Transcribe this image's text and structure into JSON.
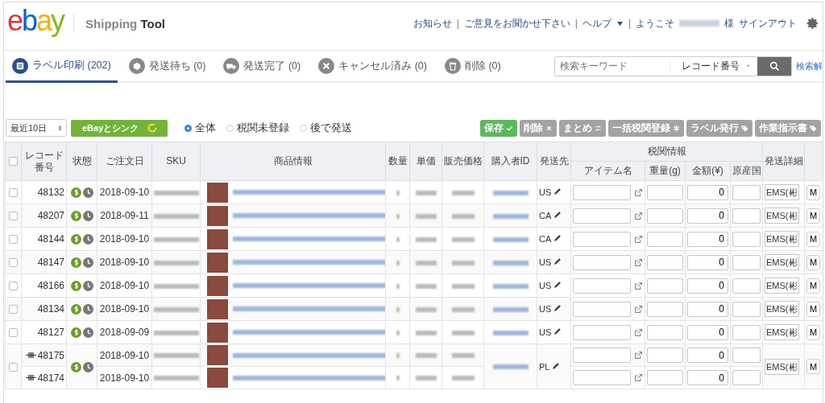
{
  "header": {
    "logo": "ebay",
    "app_name": {
      "light": "Shipping",
      "bold": "Tool"
    },
    "nav": [
      {
        "label": "お知らせ",
        "kind": "link"
      },
      {
        "label": "|",
        "kind": "separator"
      },
      {
        "label": "ご意見をお聞かせ下さい",
        "kind": "link"
      },
      {
        "label": "|",
        "kind": "separator"
      },
      {
        "label": "ヘルプ",
        "kind": "dropdown"
      },
      {
        "label": "|",
        "kind": "separator"
      },
      {
        "label": "ようこそ",
        "kind": "welcome",
        "suffix": "様"
      },
      {
        "label": "サインアウト",
        "kind": "link"
      }
    ]
  },
  "tabs": [
    {
      "label": "ラベル印刷 (202)",
      "kind": "list",
      "selected": true
    },
    {
      "label": "発送待ち (0)",
      "kind": "box",
      "selected": false
    },
    {
      "label": "発送完了 (0)",
      "kind": "truck",
      "selected": false
    },
    {
      "label": "キャンセル済み (0)",
      "kind": "cancel",
      "selected": false
    },
    {
      "label": "削除 (0)",
      "kind": "trash",
      "selected": false
    }
  ],
  "search": {
    "placeholder": "検索キーワード",
    "field_select": "レコード番号",
    "clear_link": "検索解"
  },
  "toolbar": {
    "period": "最近10日",
    "sync_button": "eBayとシンク",
    "filters": [
      {
        "label": "全体",
        "selected": true
      },
      {
        "label": "税関未登録",
        "selected": false
      },
      {
        "label": "後で発送",
        "selected": false
      }
    ],
    "actions": [
      {
        "label": "保存",
        "kind": "save",
        "disabled": false
      },
      {
        "label": "削除",
        "kind": "delete",
        "disabled": true
      },
      {
        "label": "まとめ",
        "kind": "merge",
        "disabled": true
      },
      {
        "label": "一括税関登録",
        "kind": "bulk",
        "disabled": true
      },
      {
        "label": "ラベル発行",
        "kind": "label",
        "disabled": true
      },
      {
        "label": "作業指示書",
        "kind": "label",
        "disabled": true
      }
    ]
  },
  "table": {
    "columns": [
      "レコード番号",
      "状態",
      "ご注文日",
      "SKU",
      "商品情報",
      "数量",
      "単価",
      "販売価格",
      "購入者ID",
      "発送先"
    ],
    "select_all_checked": false,
    "customs_group": "税関情報",
    "customs_columns": [
      "アイテム名",
      "重量(g)",
      "金額(¥)",
      "原産国"
    ],
    "last_column": "発送詳細",
    "orders": [
      {
        "merged": false,
        "checked": false,
        "destination": "US",
        "shipping": "EMS(彬",
        "action": "M",
        "items": [
          {
            "record": "48132",
            "date": "2018-09-10",
            "amount": "0"
          }
        ]
      },
      {
        "merged": false,
        "checked": false,
        "destination": "CA",
        "shipping": "EMS(彬",
        "action": "M",
        "items": [
          {
            "record": "48207",
            "date": "2018-09-11",
            "amount": "0"
          }
        ]
      },
      {
        "merged": false,
        "checked": false,
        "destination": "CA",
        "shipping": "EMS(彬",
        "action": "M",
        "items": [
          {
            "record": "48144",
            "date": "2018-09-10",
            "amount": "0"
          }
        ]
      },
      {
        "merged": false,
        "checked": false,
        "destination": "US",
        "shipping": "EMS(彬",
        "action": "M",
        "items": [
          {
            "record": "48147",
            "date": "2018-09-10",
            "amount": "0"
          }
        ]
      },
      {
        "merged": false,
        "checked": false,
        "destination": "US",
        "shipping": "EMS(彬",
        "action": "M",
        "items": [
          {
            "record": "48166",
            "date": "2018-09-10",
            "amount": "0"
          }
        ]
      },
      {
        "merged": false,
        "checked": false,
        "destination": "US",
        "shipping": "EMS(彬",
        "action": "M",
        "items": [
          {
            "record": "48134",
            "date": "2018-09-10",
            "amount": "0"
          }
        ]
      },
      {
        "merged": false,
        "checked": false,
        "destination": "US",
        "shipping": "EMS(彬",
        "action": "M",
        "items": [
          {
            "record": "48127",
            "date": "2018-09-09",
            "amount": "0"
          }
        ]
      },
      {
        "merged": true,
        "checked": false,
        "destination": "PL",
        "shipping": "EMS(彬",
        "action": "M",
        "items": [
          {
            "record": "48175",
            "date": "2018-09-10",
            "amount": "0"
          },
          {
            "record": "48174",
            "date": "2018-09-10",
            "amount": "0"
          }
        ]
      }
    ]
  }
}
